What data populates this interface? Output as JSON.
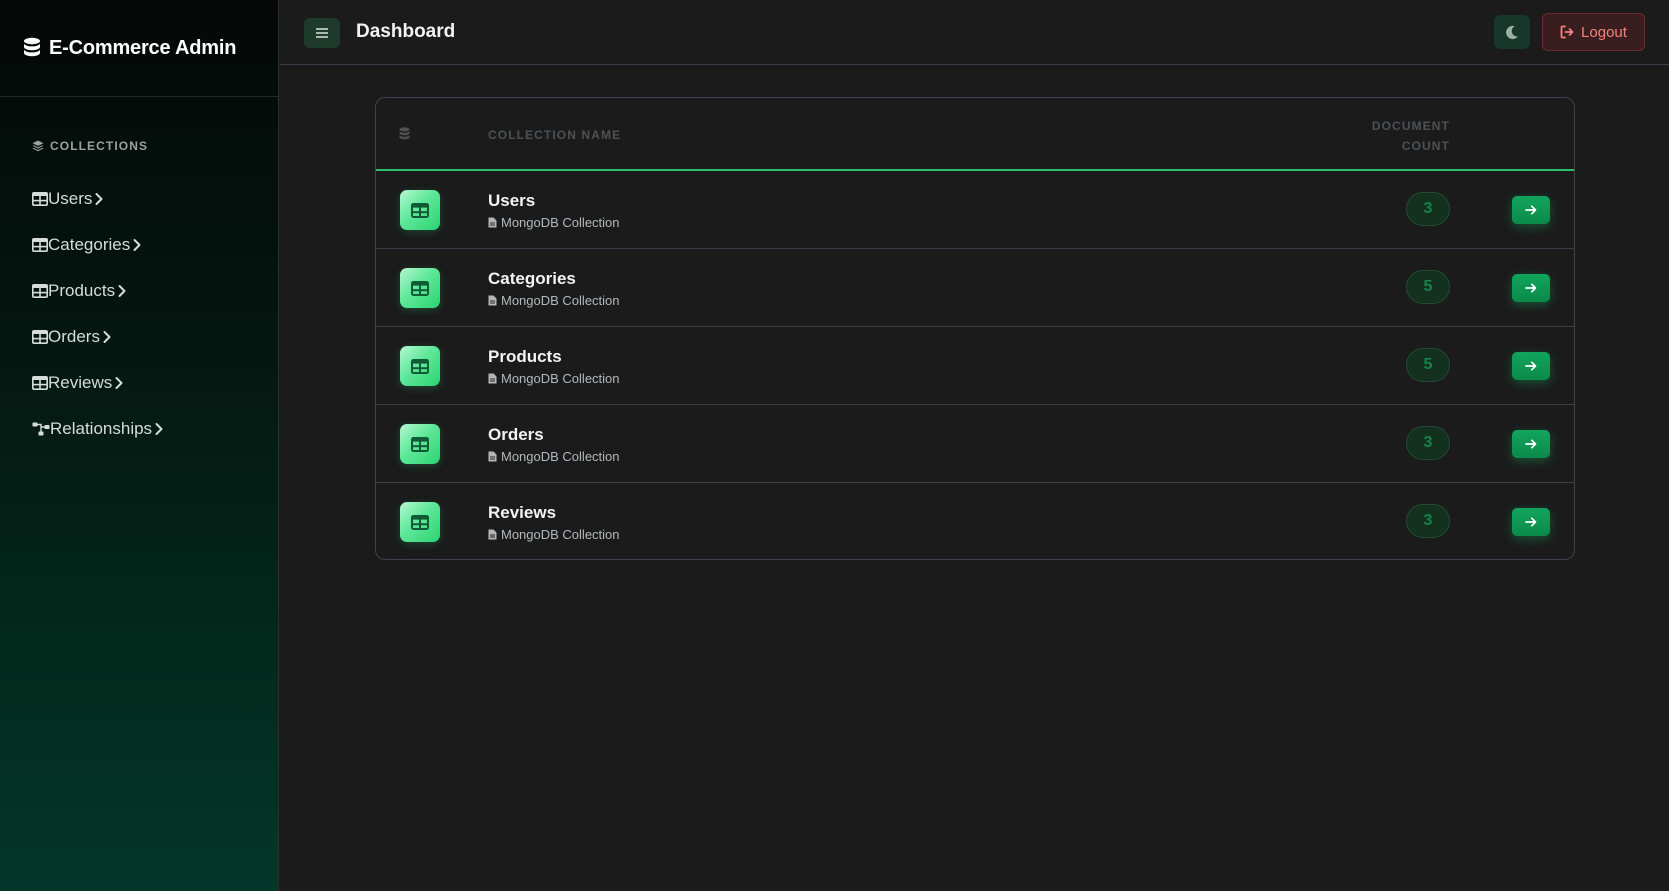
{
  "sidebar": {
    "brand": {
      "title": "E-Commerce Admin",
      "icon": "database-icon"
    },
    "section_label": "COLLECTIONS",
    "items": [
      {
        "label": "Users",
        "icon": "table-icon"
      },
      {
        "label": "Categories",
        "icon": "table-icon"
      },
      {
        "label": "Products",
        "icon": "table-icon"
      },
      {
        "label": "Orders",
        "icon": "table-icon"
      },
      {
        "label": "Reviews",
        "icon": "table-icon"
      },
      {
        "label": "Relationships",
        "icon": "sitemap-icon"
      }
    ]
  },
  "header": {
    "title": "Dashboard",
    "logout_label": "Logout"
  },
  "table": {
    "columns": {
      "name": "COLLECTION NAME",
      "count_line1": "DOCUMENT",
      "count_line2": "COUNT"
    },
    "rows": [
      {
        "name": "Users",
        "subtitle": "MongoDB Collection",
        "count": "3"
      },
      {
        "name": "Categories",
        "subtitle": "MongoDB Collection",
        "count": "5"
      },
      {
        "name": "Products",
        "subtitle": "MongoDB Collection",
        "count": "5"
      },
      {
        "name": "Orders",
        "subtitle": "MongoDB Collection",
        "count": "3"
      },
      {
        "name": "Reviews",
        "subtitle": "MongoDB Collection",
        "count": "3"
      }
    ]
  },
  "colors": {
    "accent": "#2fbf6a",
    "sidebar_bottom": "#03372a",
    "logout_text": "#f2837f",
    "badge_text": "#16834b"
  }
}
